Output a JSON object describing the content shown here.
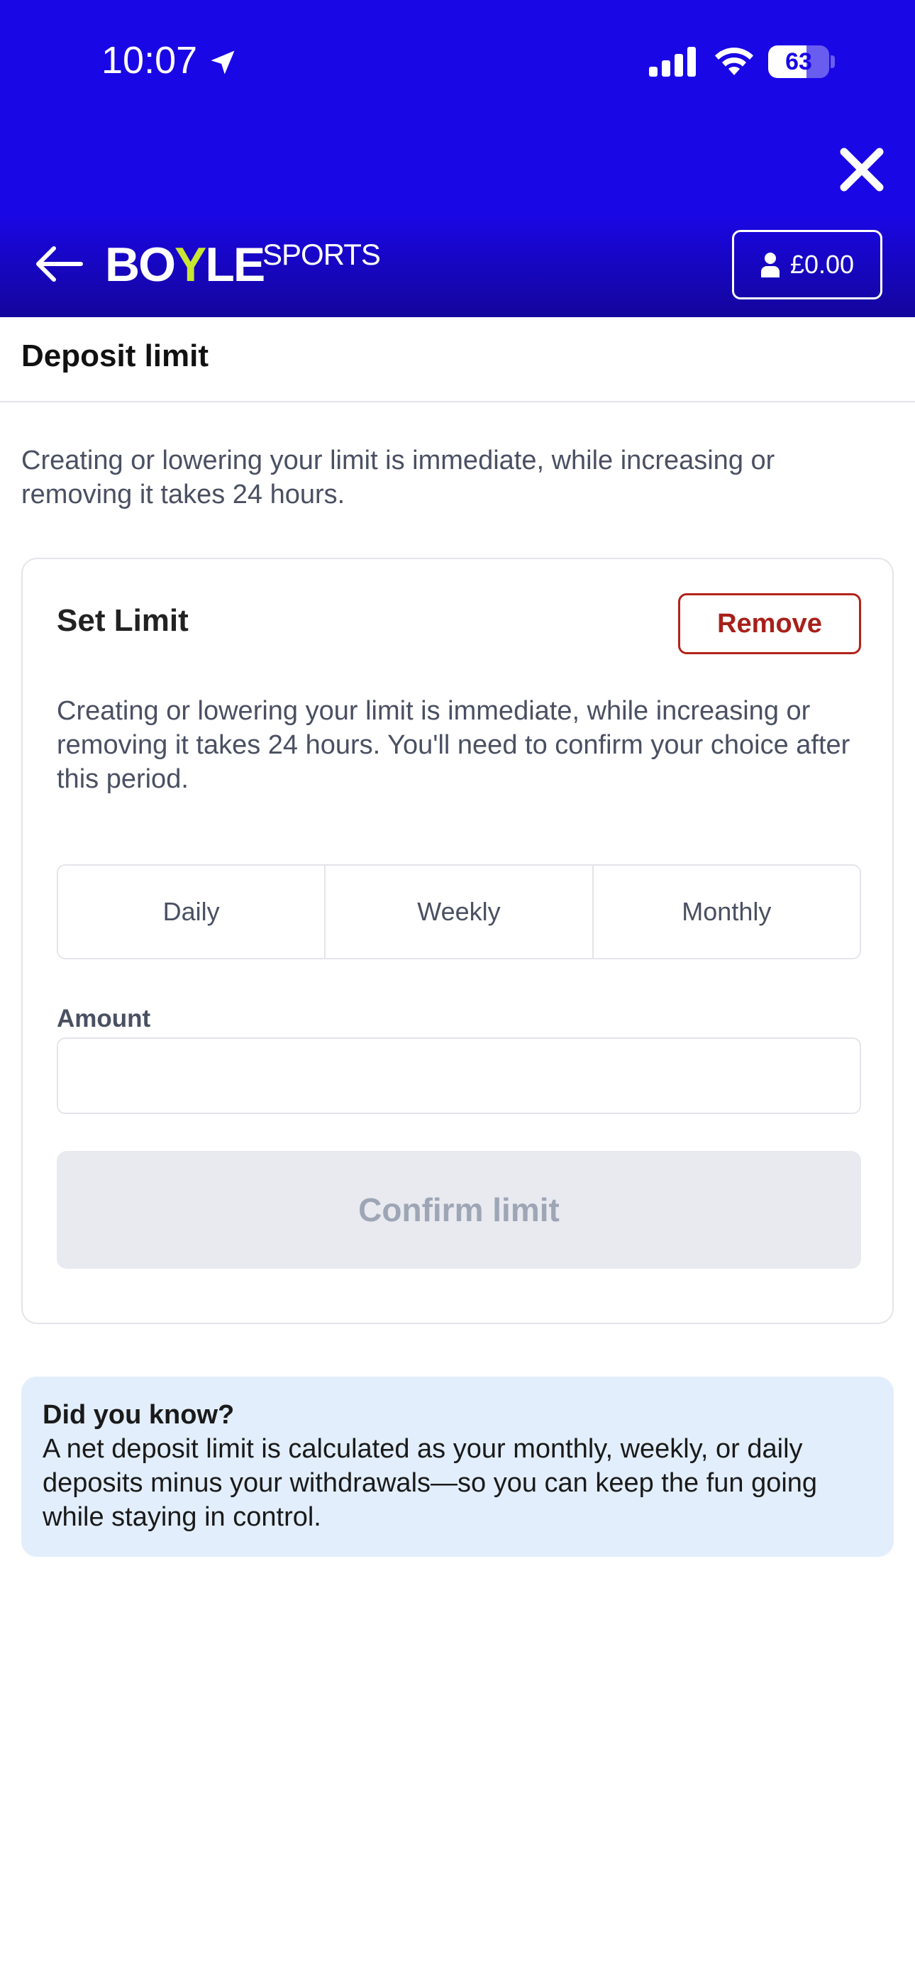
{
  "status_bar": {
    "time": "10:07",
    "battery_level": "63",
    "battery_fraction": 0.63
  },
  "header": {
    "logo_main_a": "BO",
    "logo_main_y": "Y",
    "logo_main_b": "LE",
    "logo_sub": "SPORTS",
    "balance": "£0.00",
    "brand_color": "#1a07e6",
    "accent_color": "#c8e632"
  },
  "page": {
    "title": "Deposit limit",
    "intro": "Creating or lowering your limit is immediate, while increasing or removing it takes 24 hours."
  },
  "card": {
    "title": "Set Limit",
    "remove_label": "Remove",
    "description": "Creating or lowering your limit is immediate, while increasing or removing it takes 24 hours. You'll need to confirm your choice after this period.",
    "periods": [
      "Daily",
      "Weekly",
      "Monthly"
    ],
    "amount_label": "Amount",
    "amount_value": "",
    "amount_placeholder": "",
    "confirm_label": "Confirm limit"
  },
  "info": {
    "title": "Did you know?",
    "text": "A net deposit limit is calculated as your monthly, weekly, or daily deposits minus your withdrawals—so you can keep the fun going while staying in control."
  },
  "icons": {
    "location": "location-arrow-icon",
    "signal": "cellular-signal-icon",
    "wifi": "wifi-icon",
    "battery": "battery-icon",
    "close": "close-icon",
    "back": "back-arrow-icon",
    "user": "user-icon"
  }
}
